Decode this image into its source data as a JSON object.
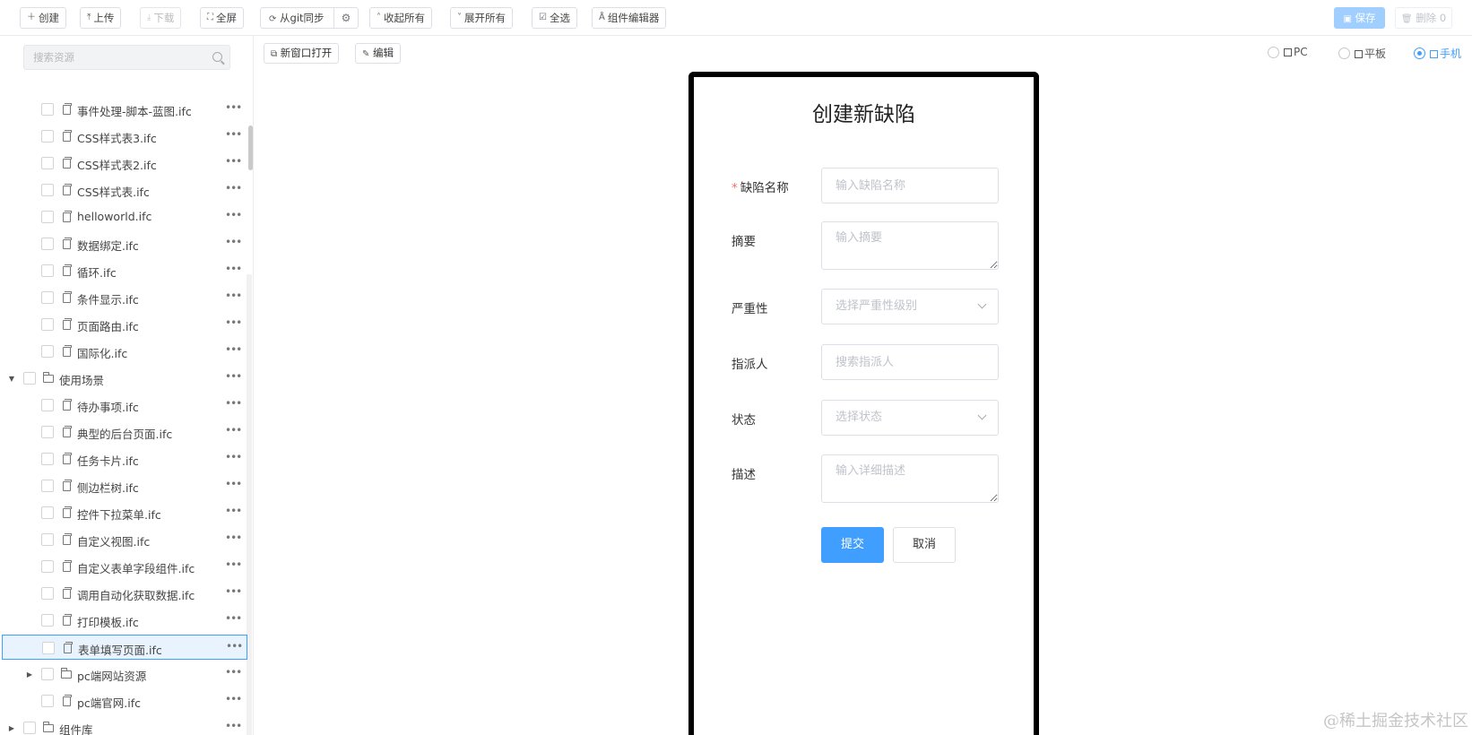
{
  "toolbar": {
    "create": "创建",
    "upload": "上传",
    "download": "下载",
    "fullscreen": "全屏",
    "git_sync": "从git同步",
    "collapse_all": "收起所有",
    "expand_all": "展开所有",
    "select_all": "全选",
    "component_editor": "组件编辑器",
    "save": "保存",
    "delete": "删除 0"
  },
  "sidebar": {
    "search_placeholder": "搜索资源",
    "items": [
      {
        "label": "事件处理-脚本-蓝图.ifc",
        "type": "file"
      },
      {
        "label": "CSS样式表3.ifc",
        "type": "file"
      },
      {
        "label": "CSS样式表2.ifc",
        "type": "file"
      },
      {
        "label": "CSS样式表.ifc",
        "type": "file"
      },
      {
        "label": "helloworld.ifc",
        "type": "file"
      },
      {
        "label": "数据绑定.ifc",
        "type": "file"
      },
      {
        "label": "循环.ifc",
        "type": "file"
      },
      {
        "label": "条件显示.ifc",
        "type": "file"
      },
      {
        "label": "页面路由.ifc",
        "type": "file"
      },
      {
        "label": "国际化.ifc",
        "type": "file"
      },
      {
        "label": "使用场景",
        "type": "folder-open"
      },
      {
        "label": "待办事项.ifc",
        "type": "file"
      },
      {
        "label": "典型的后台页面.ifc",
        "type": "file"
      },
      {
        "label": "任务卡片.ifc",
        "type": "file"
      },
      {
        "label": "侧边栏树.ifc",
        "type": "file"
      },
      {
        "label": "控件下拉菜单.ifc",
        "type": "file"
      },
      {
        "label": "自定义视图.ifc",
        "type": "file"
      },
      {
        "label": "自定义表单字段组件.ifc",
        "type": "file"
      },
      {
        "label": "调用自动化获取数据.ifc",
        "type": "file"
      },
      {
        "label": "打印模板.ifc",
        "type": "file"
      },
      {
        "label": "表单填写页面.ifc",
        "type": "file",
        "selected": true
      },
      {
        "label": "pc端网站资源",
        "type": "folder-closed"
      },
      {
        "label": "pc端官网.ifc",
        "type": "file"
      },
      {
        "label": "组件库",
        "type": "folder-closed-root"
      }
    ]
  },
  "preview": {
    "open_new_window": "新窗口打开",
    "edit": "编辑",
    "devices": [
      "PC",
      "平板",
      "手机"
    ],
    "selected_device": "手机"
  },
  "form": {
    "title": "创建新缺陷",
    "fields": {
      "name_label": "缺陷名称",
      "name_placeholder": "输入缺陷名称",
      "summary_label": "摘要",
      "summary_placeholder": "输入摘要",
      "severity_label": "严重性",
      "severity_placeholder": "选择严重性级别",
      "assignee_label": "指派人",
      "assignee_placeholder": "搜索指派人",
      "status_label": "状态",
      "status_placeholder": "选择状态",
      "description_label": "描述",
      "description_placeholder": "输入详细描述"
    },
    "submit": "提交",
    "cancel": "取消"
  },
  "watermark": "@稀土掘金技术社区",
  "colors": {
    "accent": "#409eff",
    "save_disabled": "#a0cfff",
    "required_star": "#f56c6c",
    "selected_row_bg": "#e8f3fd"
  }
}
